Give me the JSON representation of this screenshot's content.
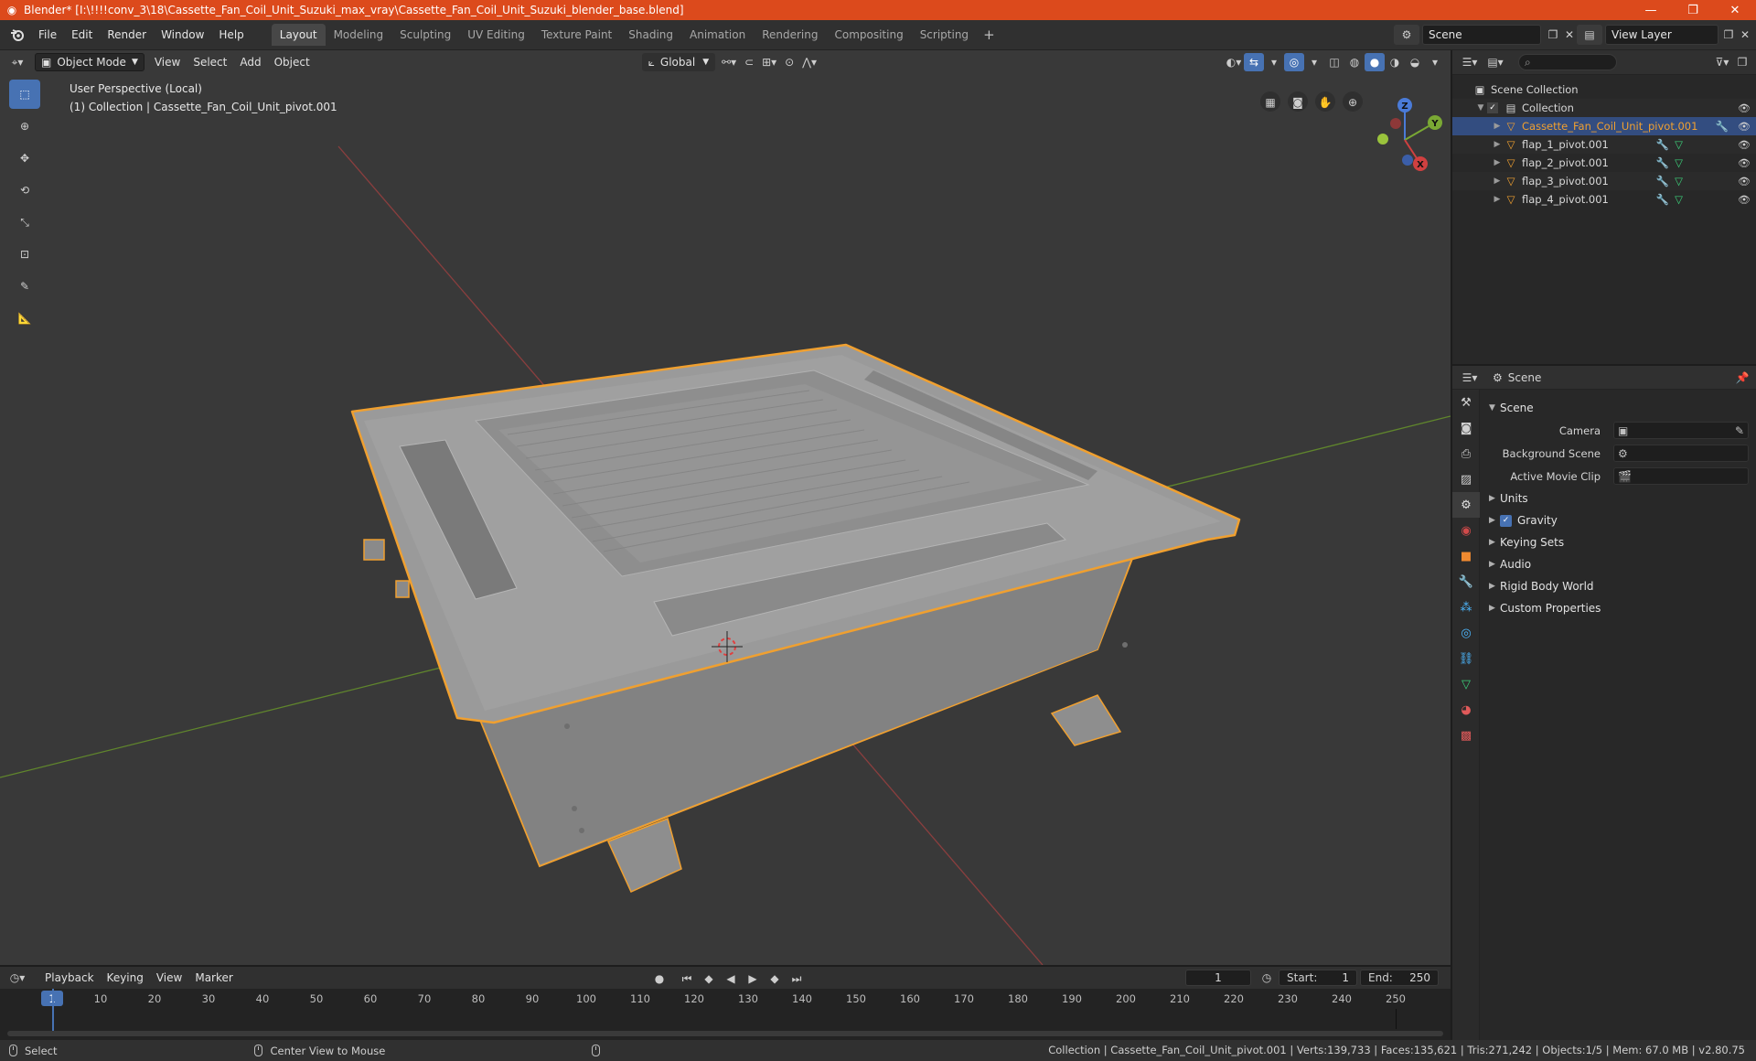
{
  "window": {
    "title": "Blender* [I:\\!!!!conv_3\\18\\Cassette_Fan_Coil_Unit_Suzuki_max_vray\\Cassette_Fan_Coil_Unit_Suzuki_blender_base.blend]",
    "minimize": "—",
    "maximize": "❐",
    "close": "✕"
  },
  "menu": [
    "File",
    "Edit",
    "Render",
    "Window",
    "Help"
  ],
  "workspaces": [
    "Layout",
    "Modeling",
    "Sculpting",
    "UV Editing",
    "Texture Paint",
    "Shading",
    "Animation",
    "Rendering",
    "Compositing",
    "Scripting"
  ],
  "active_workspace": "Layout",
  "scene_name": "Scene",
  "view_layer": "View Layer",
  "viewport": {
    "mode": "Object Mode",
    "menus": [
      "View",
      "Select",
      "Add",
      "Object"
    ],
    "transform_orientation": "Global",
    "perspective_label": "User Perspective (Local)",
    "collection_label": "(1) Collection | Cassette_Fan_Coil_Unit_pivot.001",
    "gizmo_axes": {
      "x": "X",
      "y": "Y",
      "z": "Z"
    }
  },
  "outliner": {
    "root": "Scene Collection",
    "collection": "Collection",
    "items": [
      {
        "name": "Cassette_Fan_Coil_Unit_pivot.001",
        "selected": true
      },
      {
        "name": "flap_1_pivot.001",
        "selected": false
      },
      {
        "name": "flap_2_pivot.001",
        "selected": false
      },
      {
        "name": "flap_3_pivot.001",
        "selected": false
      },
      {
        "name": "flap_4_pivot.001",
        "selected": false
      }
    ]
  },
  "properties": {
    "header_title": "Scene",
    "section": "Scene",
    "fields": [
      {
        "label": "Camera",
        "value": ""
      },
      {
        "label": "Background Scene",
        "value": ""
      },
      {
        "label": "Active Movie Clip",
        "value": ""
      }
    ],
    "subsections": [
      {
        "label": "Units",
        "checkbox": false
      },
      {
        "label": "Gravity",
        "checkbox": true
      },
      {
        "label": "Keying Sets",
        "checkbox": false
      },
      {
        "label": "Audio",
        "checkbox": false
      },
      {
        "label": "Rigid Body World",
        "checkbox": false
      },
      {
        "label": "Custom Properties",
        "checkbox": false
      }
    ]
  },
  "timeline": {
    "menus": [
      "Playback",
      "Keying",
      "View",
      "Marker"
    ],
    "current_frame": "1",
    "start_label": "Start:",
    "start": "1",
    "end_label": "End:",
    "end": "250",
    "ticks": [
      "10",
      "20",
      "30",
      "40",
      "50",
      "60",
      "70",
      "80",
      "90",
      "100",
      "110",
      "120",
      "130",
      "140",
      "150",
      "160",
      "170",
      "180",
      "190",
      "200",
      "210",
      "220",
      "230",
      "240",
      "250"
    ]
  },
  "status": {
    "left_action": "Select",
    "middle_action": "Center View to Mouse",
    "stats": "Collection | Cassette_Fan_Coil_Unit_pivot.001 | Verts:139,733 | Faces:135,621 | Tris:271,242 | Objects:1/5 | Mem: 67.0 MB | v2.80.75"
  },
  "colors": {
    "title_bar": "#dc4a1c",
    "accent": "#4772b3",
    "selection": "#f0a030",
    "viewport_bg": "#393939"
  }
}
